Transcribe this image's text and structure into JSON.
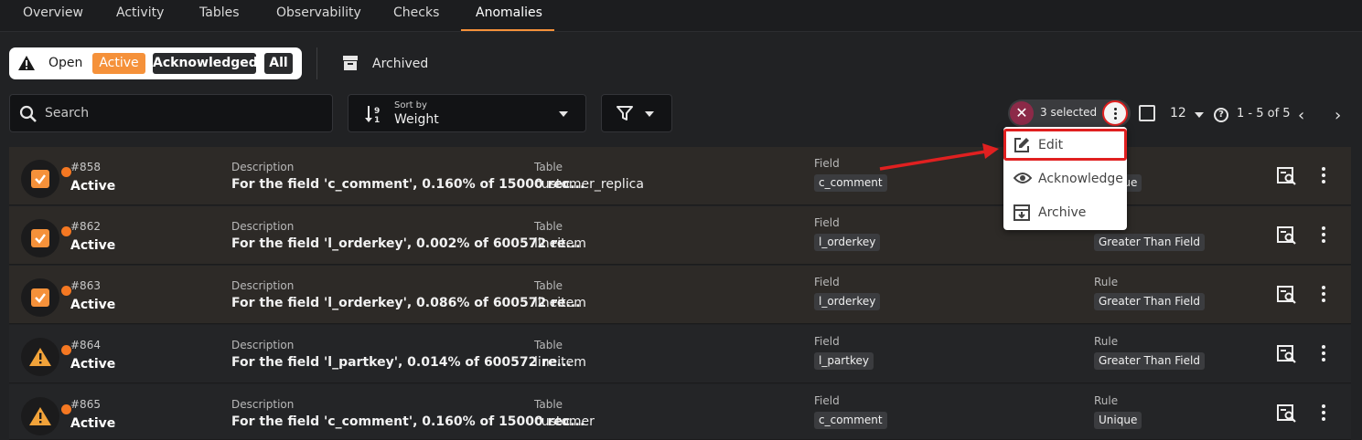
{
  "tabs": [
    {
      "label": "Overview"
    },
    {
      "label": "Activity"
    },
    {
      "label": "Tables"
    },
    {
      "label": "Observability"
    },
    {
      "label": "Checks"
    },
    {
      "label": "Anomalies",
      "active": true
    }
  ],
  "status_filter": {
    "open_label": "Open",
    "active_label": "Active",
    "acknowledged_label": "Acknowledged",
    "all_label": "All",
    "archived_label": "Archived"
  },
  "toolbar": {
    "search_placeholder": "Search",
    "sort_caption": "Sort by",
    "sort_value": "Weight",
    "selected_text": "3 selected",
    "page_size": "12",
    "page_range": "1 - 5 of 5"
  },
  "menu": {
    "edit": "Edit",
    "acknowledge": "Acknowledge",
    "archive": "Archive"
  },
  "columns": {
    "description": "Description",
    "table": "Table",
    "field": "Field",
    "rule": "Rule"
  },
  "rows": [
    {
      "id": "#858",
      "status": "Active",
      "checked": true,
      "description": "For the field 'c_comment', 0.160% of 15000 rec...",
      "table": "customer_replica",
      "field": "c_comment",
      "rule": "Unique"
    },
    {
      "id": "#862",
      "status": "Active",
      "checked": true,
      "description": "For the field 'l_orderkey', 0.002% of 600572 re...",
      "table": "lineitem",
      "field": "l_orderkey",
      "rule": "Greater Than Field"
    },
    {
      "id": "#863",
      "status": "Active",
      "checked": true,
      "description": "For the field 'l_orderkey', 0.086% of 600572 re...",
      "table": "lineitem",
      "field": "l_orderkey",
      "rule": "Greater Than Field"
    },
    {
      "id": "#864",
      "status": "Active",
      "checked": false,
      "description": "For the field 'l_partkey', 0.014% of 600572 re...",
      "table": "lineitem",
      "field": "l_partkey",
      "rule": "Greater Than Field"
    },
    {
      "id": "#865",
      "status": "Active",
      "checked": false,
      "description": "For the field 'c_comment', 0.160% of 15000 rec...",
      "table": "customer",
      "field": "c_comment",
      "rule": "Unique"
    }
  ],
  "colors": {
    "accent": "#f5913a",
    "highlight": "#e02020",
    "badge_dot": "#f57822",
    "clear_button": "#8c2a48"
  }
}
